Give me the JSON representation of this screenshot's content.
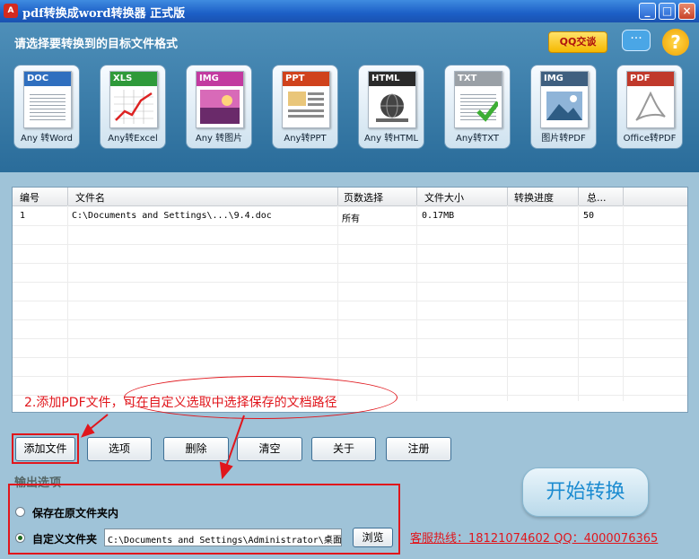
{
  "window": {
    "title": "pdf转换成word转换器 正式版",
    "logo_text": "A",
    "controls": {
      "minimize": "_",
      "maximize": "□",
      "close": "×"
    }
  },
  "toolbar": {
    "prompt": "请选择要转换到的目标文件格式",
    "qq_chat_label": "QQ交谈",
    "chat_icon": "speech-bubble-icon",
    "help_icon": "question-mark-icon",
    "tools": [
      {
        "tag": "DOC",
        "label": "Any 转Word",
        "color": "#2f6fbf"
      },
      {
        "tag": "XLS",
        "label": "Any转Excel",
        "color": "#2f9a3a"
      },
      {
        "tag": "IMG",
        "label": "Any 转图片",
        "color": "#c23aa0"
      },
      {
        "tag": "PPT",
        "label": "Any转PPT",
        "color": "#d0421c"
      },
      {
        "tag": "HTML",
        "label": "Any 转HTML",
        "color": "#2a2a2a"
      },
      {
        "tag": "TXT",
        "label": "Any转TXT",
        "color": "#9aa0a6"
      },
      {
        "tag": "IMG",
        "label": "图片转PDF",
        "color": "#3f5f7f"
      },
      {
        "tag": "PDF",
        "label": "Office转PDF",
        "color": "#c0392b"
      }
    ]
  },
  "table": {
    "columns": [
      "编号",
      "文件名",
      "页数选择",
      "文件大小",
      "转换进度",
      "总..."
    ],
    "rows": [
      [
        "1",
        "C:\\Documents and Settings\\...\\9.4.doc",
        "所有",
        "0.17MB",
        "",
        "50"
      ]
    ]
  },
  "annotation": {
    "text": "2.添加PDF文件，可在自定义选取中选择保存的文档路径",
    "color": "#e0161c"
  },
  "buttons": {
    "add_file": "添加文件",
    "options": "选项",
    "delete": "删除",
    "clear": "清空",
    "about": "关于",
    "register": "注册"
  },
  "output": {
    "heading": "输出选项",
    "save_original": "保存在原文件夹内",
    "custom_folder": "自定义文件夹",
    "selected": "custom_folder",
    "path_value": "C:\\Documents and Settings\\Administrator\\桌面",
    "browse": "浏览"
  },
  "start_button": "开始转换",
  "hotline": "客服热线：18121074602 QQ：4000076365"
}
